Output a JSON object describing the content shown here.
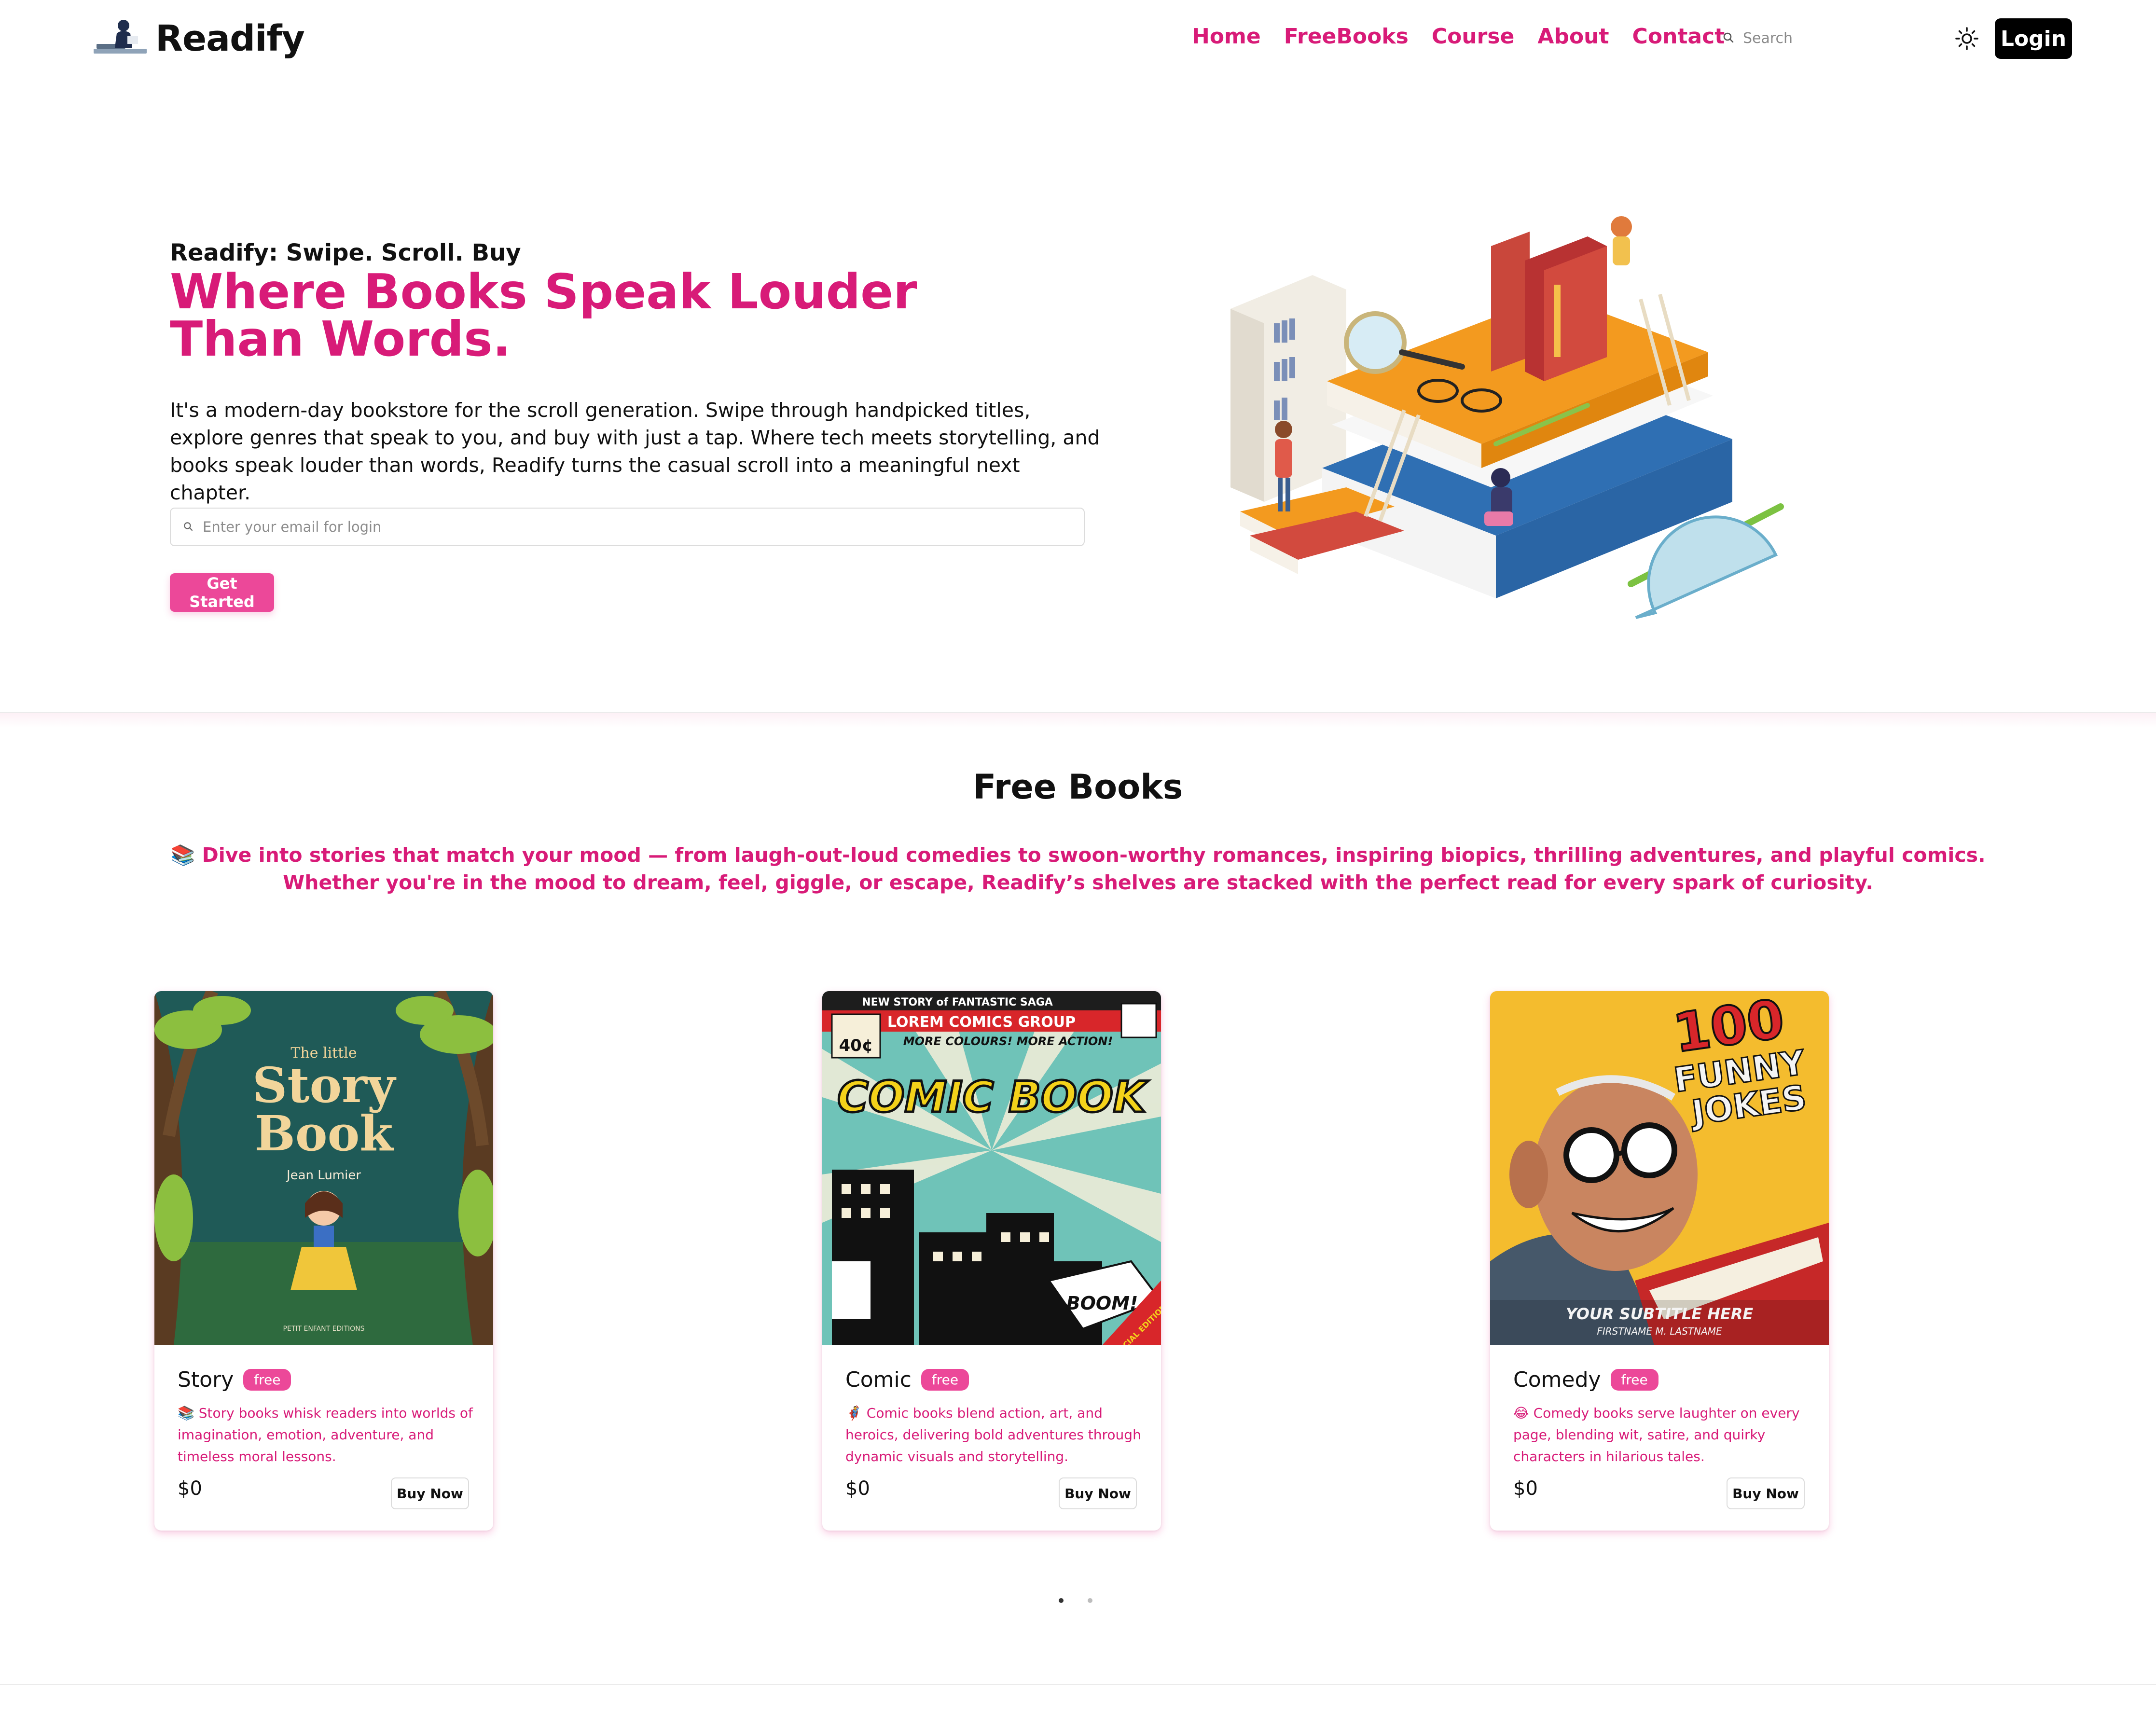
{
  "brand": {
    "name": "Readify"
  },
  "nav": {
    "items": [
      {
        "label": "Home"
      },
      {
        "label": "FreeBooks"
      },
      {
        "label": "Course"
      },
      {
        "label": "About"
      },
      {
        "label": "Contact"
      }
    ],
    "search_placeholder": "Search",
    "login_label": "Login"
  },
  "hero": {
    "tagline": "Readify: Swipe. Scroll. Buy",
    "title": "Where Books Speak Louder Than Words.",
    "description": "It's a modern-day bookstore for the scroll generation. Swipe through handpicked titles, explore genres that speak to you, and buy with just a tap. Where tech meets storytelling, and books speak louder than words, Readify turns the casual scroll into a meaningful next chapter.",
    "email_placeholder": "Enter your email for login",
    "cta_label": "Get Started"
  },
  "free_books": {
    "title": "Free Books",
    "description": "📚 Dive into stories that match your mood — from laugh-out-loud comedies to swoon-worthy romances, inspiring biopics, thrilling adventures, and playful comics. Whether you're in the mood to dream, feel, giggle, or escape, Readify’s shelves are stacked with the perfect read for every spark of curiosity.",
    "cards": [
      {
        "title": "Story",
        "badge": "free",
        "description": "📚 Story books whisk readers into worlds of imagination, emotion, adventure, and timeless moral lessons.",
        "price": "$0",
        "button": "Buy Now",
        "cover": {
          "lines": [
            "The little",
            "Story",
            "Book"
          ],
          "author": "Jean Lumier",
          "publisher": "PETIT ENFANT EDITIONS"
        }
      },
      {
        "title": "Comic",
        "badge": "free",
        "description": "🦸 Comic books blend action, art, and heroics, delivering bold adventures through dynamic visuals and storytelling.",
        "price": "$0",
        "button": "Buy Now",
        "cover": {
          "top": "NEW STORY of FANTASTIC SAGA",
          "group": "LOREM COMICS GROUP",
          "tagline": "MORE COLOURS! MORE ACTION!",
          "price_tag": "40¢",
          "title": "COMIC BOOK",
          "bubble": "BOOM!",
          "edition": "SPECIAL EDITION"
        }
      },
      {
        "title": "Comedy",
        "badge": "free",
        "description": "😂 Comedy books serve laughter on every page, blending wit, satire, and quirky characters in hilarious tales.",
        "price": "$0",
        "button": "Buy Now",
        "cover": {
          "number": "100",
          "line1": "FUNNY",
          "line2": "JOKES",
          "subtitle": "YOUR SUBTITLE HERE",
          "author": "FIRSTNAME M. LASTNAME"
        }
      }
    ]
  },
  "carousel": {
    "pages": 2,
    "active": 0
  },
  "colors": {
    "accent": "#d81b78",
    "button": "#ec4899",
    "login_bg": "#000000"
  }
}
